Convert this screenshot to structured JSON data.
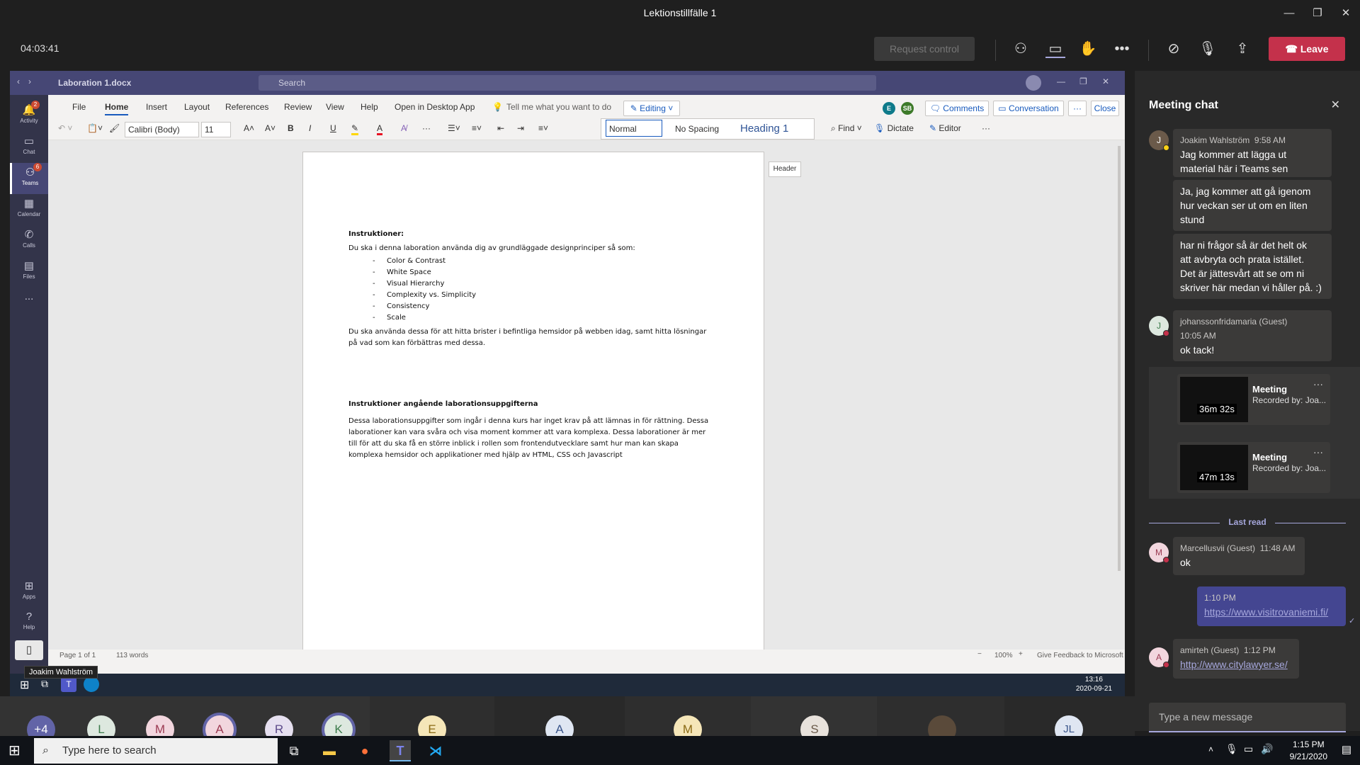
{
  "window": {
    "title": "Lektionstillfälle 1"
  },
  "meeting": {
    "timer": "04:03:41",
    "request_control": "Request control",
    "leave": "Leave"
  },
  "shared": {
    "doc_title": "Laboration 1.docx",
    "search_placeholder": "Search",
    "rail": [
      {
        "label": "Activity",
        "badge": "2"
      },
      {
        "label": "Chat"
      },
      {
        "label": "Teams",
        "badge": "6"
      },
      {
        "label": "Calendar"
      },
      {
        "label": "Calls"
      },
      {
        "label": "Files"
      },
      {
        "label": "..."
      }
    ],
    "rail_bottom": [
      {
        "label": "Apps"
      },
      {
        "label": "Help"
      }
    ],
    "menu": [
      "File",
      "Home",
      "Insert",
      "Layout",
      "References",
      "Review",
      "View",
      "Help",
      "Open in Desktop App"
    ],
    "tell_me": "Tell me what you want to do",
    "editing": "Editing",
    "comments": "Comments",
    "conversation": "Conversation",
    "close": "Close",
    "font": "Calibri (Body)",
    "font_size": "11",
    "styles": [
      "Normal",
      "No Spacing",
      "Heading 1"
    ],
    "find": "Find",
    "dictate": "Dictate",
    "editor": "Editor",
    "collab_avatars": [
      "E",
      "SB"
    ],
    "header_tag": "Header",
    "document": {
      "heading1": "Instruktioner:",
      "intro": "Du ska i denna laboration använda dig av grundläggade designprinciper så som:",
      "bullets": [
        "Color & Contrast",
        "White Space",
        "Visual Hierarchy",
        "Complexity vs. Simplicity",
        "Consistency",
        "Scale"
      ],
      "para1": "Du ska använda dessa för att hitta brister i befintliga hemsidor på webben idag, samt hitta lösningar",
      "para1b": "på vad som kan förbättras med dessa.",
      "heading2": "Instruktioner angående laborationsuppgifterna",
      "para2": [
        "Dessa laborationsuppgifter som ingår i denna kurs har inget krav på att lämnas in för rättning. Dessa",
        "laborationer kan vara svåra och visa moment kommer att vara komplexa. Dessa laborationer är mer",
        "till för att du ska få en större inblick i rollen som frontendutvecklare samt hur man kan skapa",
        "komplexa hemsidor och applikationer med hjälp av HTML, CSS och Javascript"
      ]
    },
    "status": {
      "page": "Page 1 of 1",
      "words": "113 words",
      "zoom": "100%",
      "feedback": "Give Feedback to Microsoft"
    },
    "presenter": "Joakim Wahlström",
    "inner_clock": {
      "time": "13:16",
      "date": "2020-09-21"
    }
  },
  "chat": {
    "title": "Meeting chat",
    "messages": [
      {
        "author": "Joakim Wahlström",
        "time": "9:58 AM",
        "lines": [
          "Jag kommer att lägga ut",
          "material här i Teams sen"
        ]
      },
      {
        "lines": [
          "Ja, jag kommer att gå igenom",
          "hur veckan ser ut om en liten",
          "stund"
        ]
      },
      {
        "lines": [
          "har ni frågor så är det helt ok",
          "att avbryta och prata istället.",
          "Det är jättesvårt att se om ni",
          "skriver här medan vi håller på. :)"
        ]
      },
      {
        "author": "johanssonfridamaria (Guest)",
        "time": "10:05 AM",
        "avatar": "J",
        "lines": [
          "ok tack!"
        ]
      },
      {
        "author": "Marcellusvii (Guest)",
        "time": "11:48 AM",
        "avatar": "M",
        "lines": [
          "ok"
        ]
      },
      {
        "time": "1:10 PM",
        "link": "https://www.visitrovaniemi.fi/"
      },
      {
        "author": "amirteh (Guest)",
        "time": "1:12 PM",
        "avatar": "A",
        "link": "http://www.citylawyer.se/"
      }
    ],
    "recordings": [
      {
        "title": "Meeting",
        "sub": "Recorded by: Joa...",
        "duration": "36m 32s"
      },
      {
        "title": "Meeting",
        "sub": "Recorded by: Joa...",
        "duration": "47m 13s"
      }
    ],
    "last_read": "Last read",
    "input_placeholder": "Type a new message"
  },
  "participants": [
    "+4",
    "L",
    "M",
    "A",
    "R",
    "K",
    "E",
    "A",
    "M",
    "S",
    "JL"
  ],
  "taskbar": {
    "search": "Type here to search",
    "time": "1:15 PM",
    "date": "9/21/2020"
  }
}
